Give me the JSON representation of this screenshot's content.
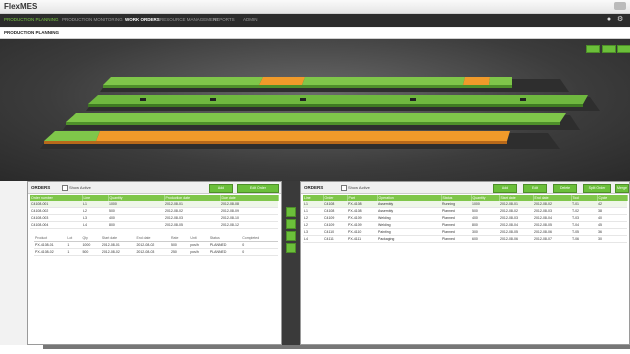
{
  "app": {
    "title": "FlexMES"
  },
  "nav": {
    "items": [
      {
        "label": "PRODUCTION PLANNING"
      },
      {
        "label": "PRODUCTION MONITORING"
      },
      {
        "label": "WORK ORDERS"
      },
      {
        "label": "RESOURCE MANAGEMENT"
      },
      {
        "label": "REPORTS"
      },
      {
        "label": "ADMIN"
      }
    ]
  },
  "breadcrumb": {
    "title": "PRODUCTION PLANNING"
  },
  "orders_panel": {
    "title": "ORDERS",
    "filter_label": "Show Active",
    "buttons": [
      "Add",
      "Edit Order"
    ],
    "columns": [
      "Order number",
      "Line",
      "Quantity",
      "Production date",
      "Due date"
    ],
    "rows": [
      [
        "C4108-001",
        "L1",
        "1000",
        "2012-08-01",
        "2012-08-08"
      ],
      [
        "C4108-002",
        "L2",
        "500",
        "2012-08-02",
        "2012-08-09"
      ],
      [
        "C4108-003",
        "L3",
        "400",
        "2012-08-03",
        "2012-08-10"
      ],
      [
        "C4108-004",
        "L4",
        "800",
        "2012-08-05",
        "2012-08-12"
      ]
    ],
    "sub_columns": [
      "Product",
      "Lot",
      "Qty",
      "Start date",
      "End date",
      "Rate",
      "Unit",
      "Status",
      "Completed"
    ],
    "sub_rows": [
      [
        "PX-4108-01",
        "1",
        "1000",
        "2012-08-01",
        "2012-08-02",
        "500",
        "pcs/h",
        "PLANNED",
        "0"
      ],
      [
        "PX-4108-02",
        "1",
        "500",
        "2012-08-02",
        "2012-08-03",
        "250",
        "pcs/h",
        "PLANNED",
        "0"
      ]
    ]
  },
  "side_buttons": [
    "move-right",
    "move-left",
    "move-up",
    "move-down"
  ],
  "ops_panel": {
    "title": "ORDERS",
    "filter_label": "Show Active",
    "buttons": [
      "Add",
      "Edit",
      "Delete",
      "Split Order",
      "Merge"
    ],
    "columns": [
      "Line",
      "Order",
      "Part",
      "Operation",
      "Status",
      "Quantity",
      "Start date",
      "End date",
      "Tool",
      "Cycle"
    ],
    "rows": [
      [
        "L1",
        "C4108",
        "PX-4108",
        "Assembly",
        "Running",
        "1000",
        "2012-08-01",
        "2012-08-02",
        "T-01",
        "42"
      ],
      [
        "L1",
        "C4108",
        "PX-4108",
        "Assembly",
        "Planned",
        "500",
        "2012-08-02",
        "2012-08-03",
        "T-02",
        "38"
      ],
      [
        "L2",
        "C4109",
        "PX-4109",
        "Welding",
        "Planned",
        "400",
        "2012-08-03",
        "2012-08-04",
        "T-03",
        "40"
      ],
      [
        "L2",
        "C4109",
        "PX-4109",
        "Welding",
        "Planned",
        "800",
        "2012-08-04",
        "2012-08-05",
        "T-04",
        "45"
      ],
      [
        "L3",
        "C4110",
        "PX-4110",
        "Painting",
        "Planned",
        "300",
        "2012-08-05",
        "2012-08-06",
        "T-05",
        "36"
      ],
      [
        "L4",
        "C4111",
        "PX-4111",
        "Packaging",
        "Planned",
        "600",
        "2012-08-06",
        "2012-08-07",
        "T-06",
        "30"
      ]
    ]
  },
  "colors": {
    "accent": "#6bbf3a",
    "highlight": "#f09a2a",
    "dark": "#2c2c2c"
  }
}
